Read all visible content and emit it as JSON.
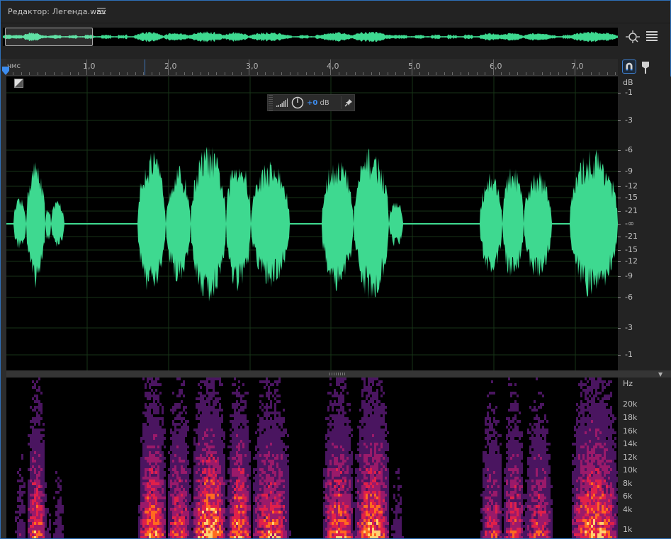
{
  "window": {
    "title": "Редактор: Легенда.wav"
  },
  "ruler": {
    "unit": "чмс",
    "labels": [
      "1,0",
      "2,0",
      "3,0",
      "4,0",
      "5,0",
      "6,0",
      "7,0"
    ]
  },
  "hud": {
    "value_number": "+0",
    "value_unit": "dB"
  },
  "db_scale": {
    "header": "dB",
    "labels": [
      "-1",
      "-3",
      "-6",
      "-9",
      "-12",
      "-15",
      "-21",
      "-∞",
      "-21",
      "-15",
      "-12",
      "-9",
      "-6",
      "-3",
      "-1"
    ]
  },
  "hz_scale": {
    "header": "Hz",
    "labels": [
      "20k",
      "18k",
      "16k",
      "14k",
      "12k",
      "10k",
      "8k",
      "6k",
      "4k",
      "1k"
    ]
  },
  "colors": {
    "waveform": "#3ed990",
    "accent": "#3d8df0",
    "background": "#000000",
    "panel": "#232323"
  },
  "icons": {
    "title_menu": "hamburger-icon",
    "zoom": "zoom-navigator-icon",
    "panel_menu": "panel-menu-icon",
    "snap": "magnet-icon",
    "marker": "marker-pin-icon",
    "channel_toggle": "channel-toggle-icon",
    "hud_meter": "level-meter-icon",
    "hud_knob": "volume-knob-icon",
    "hud_pin": "pin-icon"
  }
}
